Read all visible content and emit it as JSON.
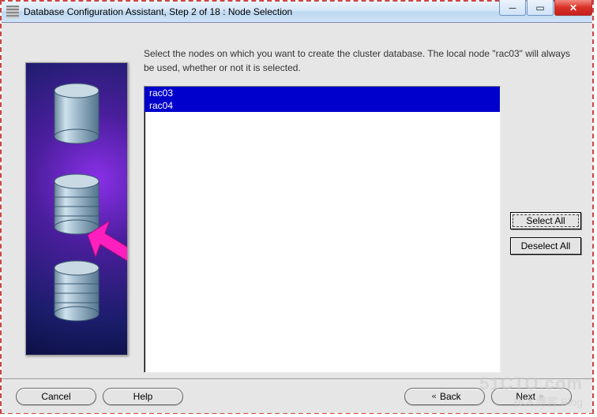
{
  "window": {
    "title": "Database Configuration Assistant, Step 2 of 18 : Node Selection"
  },
  "instruction": "Select the nodes on which you want to create the cluster database. The local node \"rac03\" will always be used, whether or not it is selected.",
  "nodes": {
    "items": [
      "rac03",
      "rac04"
    ]
  },
  "buttons": {
    "select_all": "Select All",
    "deselect_all": "Deselect All",
    "cancel": "Cancel",
    "help": "Help",
    "back": "Back",
    "next": "Next"
  },
  "watermark": {
    "line1": "51CTO.com",
    "line2": "技术博客   Blog"
  }
}
